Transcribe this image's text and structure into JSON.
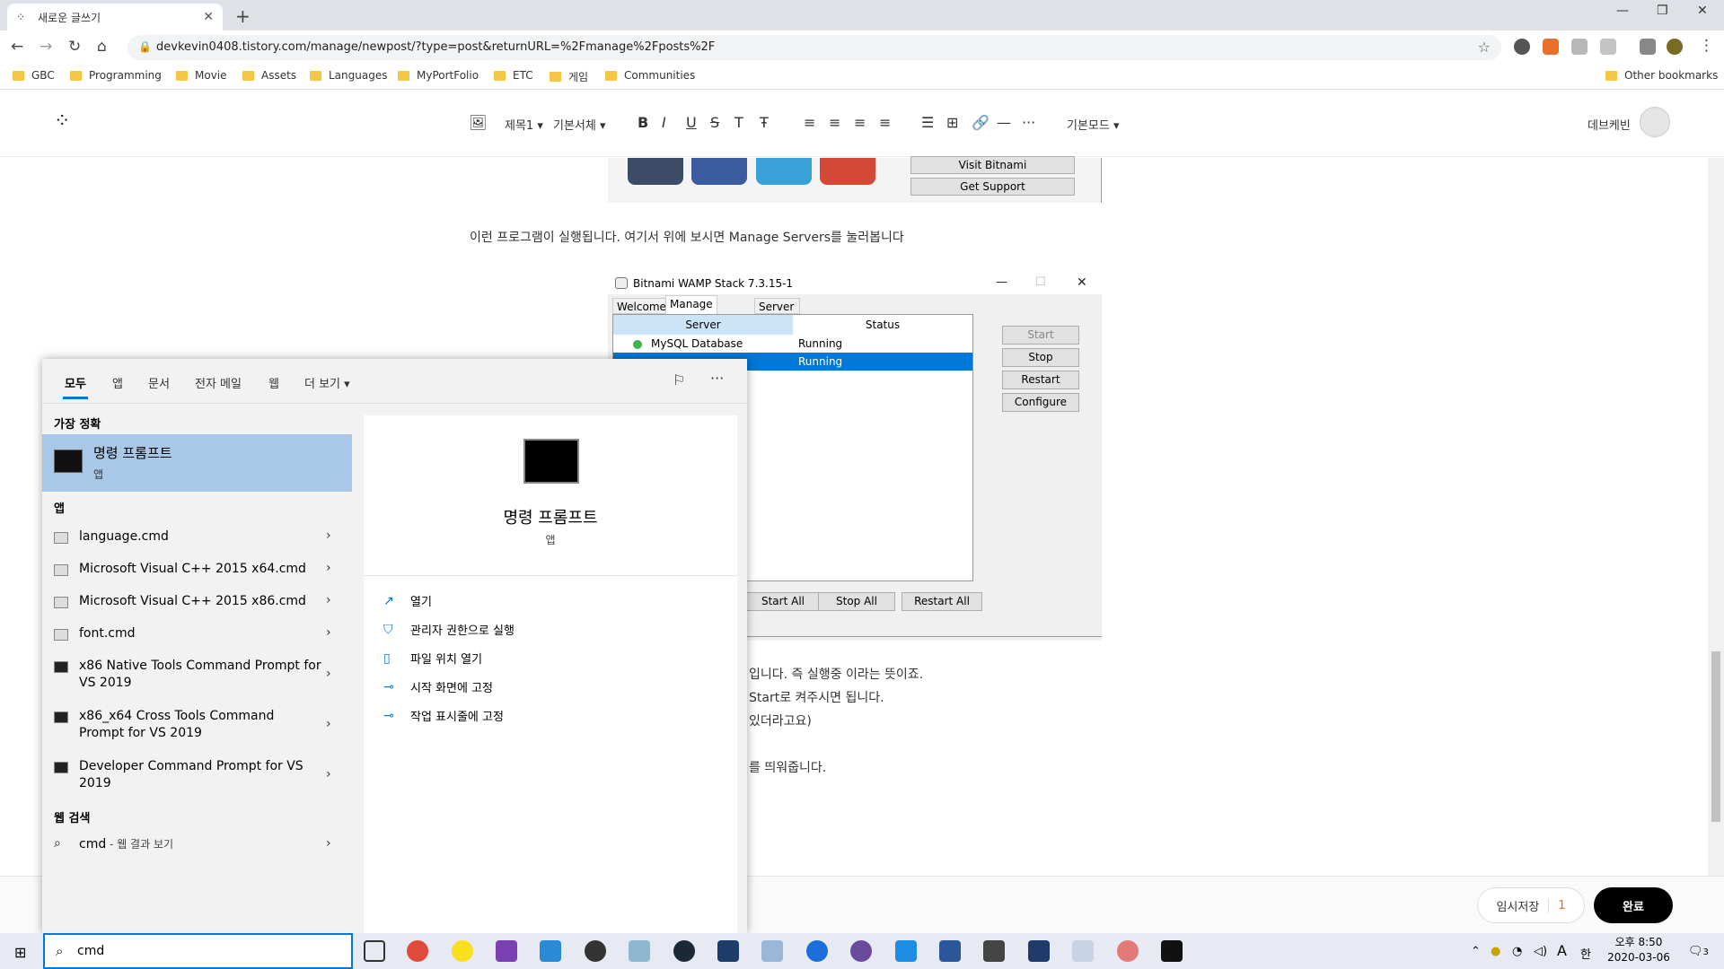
{
  "browser": {
    "tab_title": "새로운 글쓰기",
    "url": "devkevin0408.tistory.com/manage/newpost/?type=post&returnURL=%2Fmanage%2Fposts%2F",
    "bookmarks": [
      "GBC",
      "Programming",
      "Movie",
      "Assets",
      "Languages",
      "MyPortFolio",
      "ETC",
      "게임",
      "Communities"
    ],
    "other_bookmarks": "Other bookmarks"
  },
  "editor": {
    "toolbar": {
      "heading": "제목1",
      "font": "기본서체",
      "mode": "기본모드"
    },
    "username": "데브케빈"
  },
  "content": {
    "visit_bitnami": "Visit Bitnami",
    "get_support": "Get Support",
    "para1": "이런 프로그램이 실행됩니다. 여기서 위에 보시면 Manage Servers를 눌러봅니다",
    "para_lines": [
      "입니다. 즉 실행중 이라는 뜻이죠.",
      "Start로 켜주시면 됩니다.",
      "있더라고요)",
      "를 띄워줍니다."
    ]
  },
  "wamp": {
    "title": "Bitnami WAMP Stack 7.3.15-1",
    "tabs": [
      "Welcome",
      "Manage Servers",
      "Server Events"
    ],
    "headers": [
      "Server",
      "Status"
    ],
    "rows": [
      {
        "server": "MySQL Database",
        "status": "Running"
      },
      {
        "server": "",
        "status": "Running"
      }
    ],
    "side_buttons": [
      "Start",
      "Stop",
      "Restart",
      "Configure"
    ],
    "bottom_buttons": [
      "Start All",
      "Stop All",
      "Restart All"
    ]
  },
  "footer": {
    "save_label": "임시저장",
    "save_count": "1",
    "done_label": "완료"
  },
  "search": {
    "tabs": [
      "모두",
      "앱",
      "문서",
      "전자 메일",
      "웹",
      "더 보기"
    ],
    "best_match_header": "가장 정확",
    "best_match": {
      "name": "명령 프롬프트",
      "type": "앱"
    },
    "apps_header": "앱",
    "apps": [
      {
        "name": "language.cmd",
        "light": true
      },
      {
        "name": "Microsoft Visual C++ 2015 x64.cmd",
        "light": true
      },
      {
        "name": "Microsoft Visual C++ 2015 x86.cmd",
        "light": true
      },
      {
        "name": "font.cmd",
        "light": true
      },
      {
        "name": "x86 Native Tools Command Prompt for VS 2019",
        "light": false
      },
      {
        "name": "x86_x64 Cross Tools Command Prompt for VS 2019",
        "light": false
      },
      {
        "name": "Developer Command Prompt for VS 2019",
        "light": false
      }
    ],
    "web_header": "웹 검색",
    "web_query": "cmd",
    "web_suffix": " - 웹 결과 보기",
    "detail": {
      "name": "명령 프롬프트",
      "type": "앱",
      "actions": [
        "열기",
        "관리자 권한으로 실행",
        "파일 위치 열기",
        "시작 화면에 고정",
        "작업 표시줄에 고정"
      ]
    },
    "query": "cmd"
  },
  "taskbar": {
    "time": "오후 8:50",
    "date": "2020-03-06",
    "ime": "한",
    "notif_count": "3"
  }
}
